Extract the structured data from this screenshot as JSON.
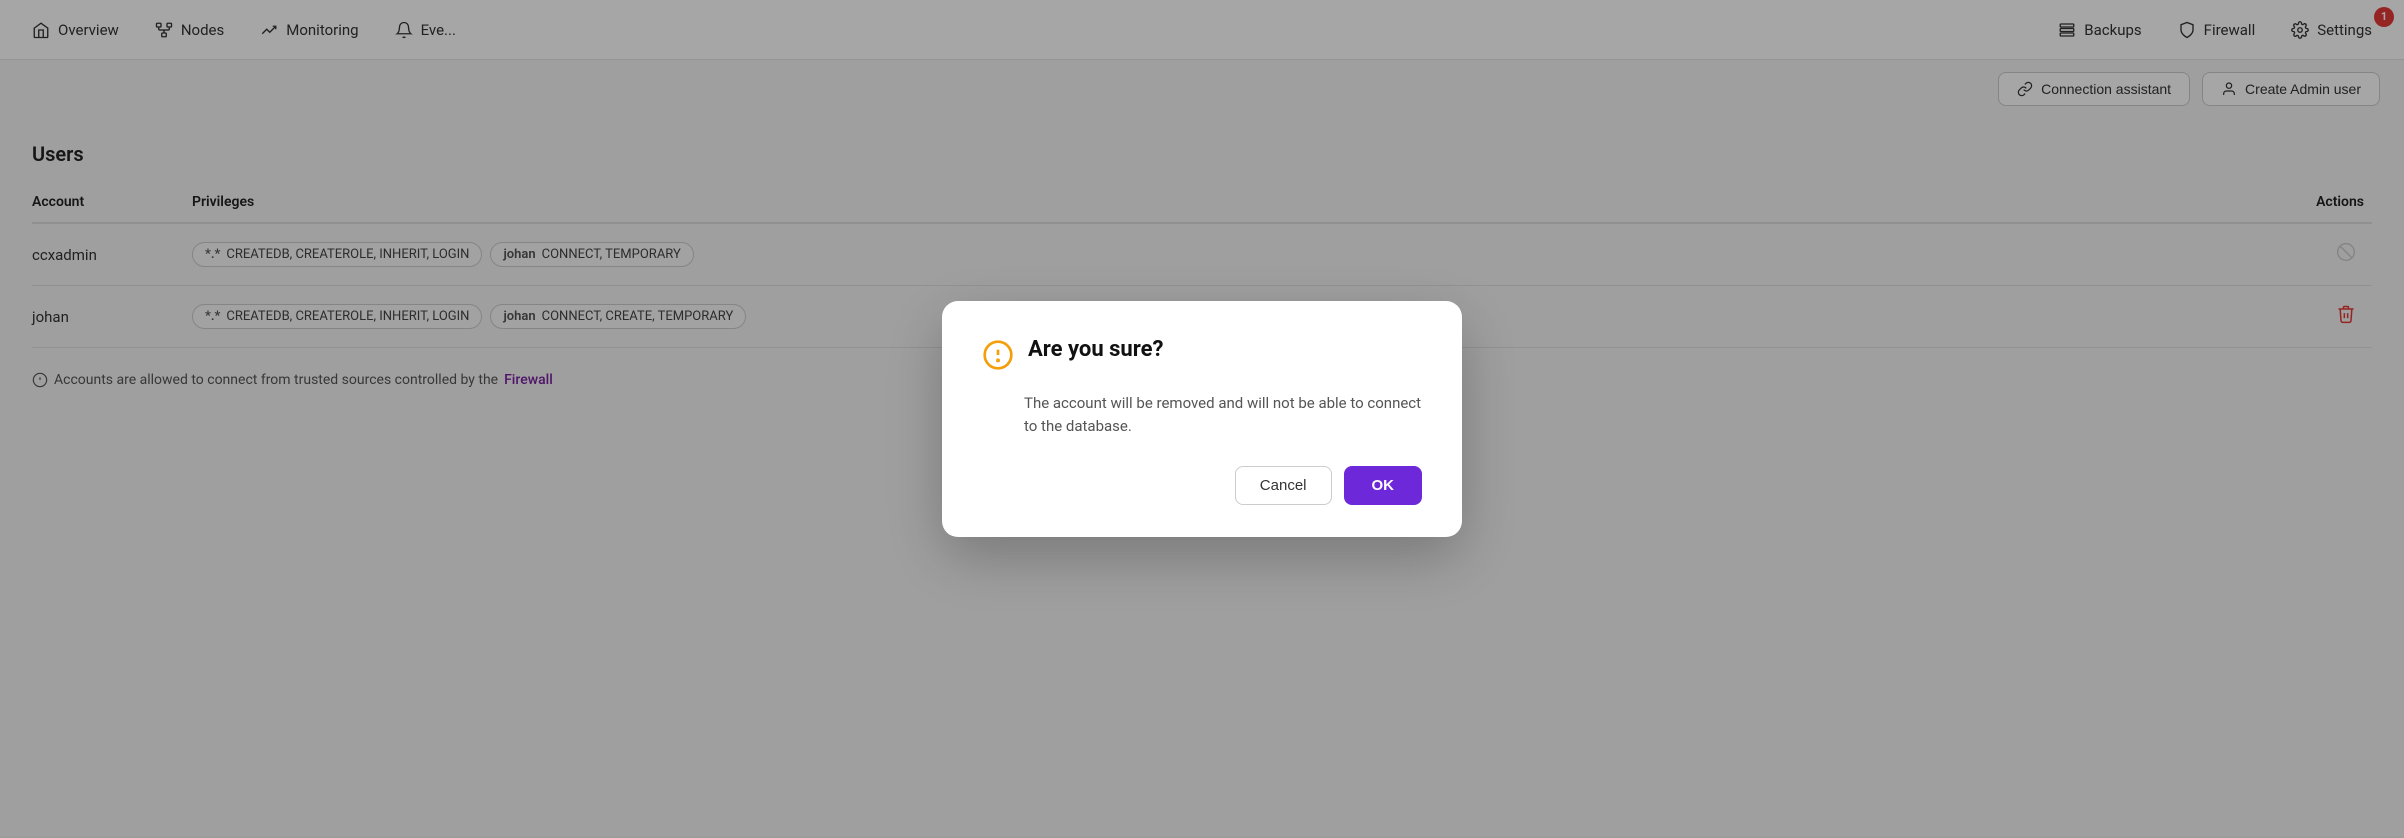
{
  "nav": {
    "items": [
      {
        "id": "overview",
        "label": "Overview",
        "icon": "home"
      },
      {
        "id": "nodes",
        "label": "Nodes",
        "icon": "nodes"
      },
      {
        "id": "monitoring",
        "label": "Monitoring",
        "icon": "chart"
      },
      {
        "id": "events",
        "label": "Eve...",
        "icon": "bell"
      },
      {
        "id": "backups",
        "label": "Backups",
        "icon": "backup"
      },
      {
        "id": "firewall",
        "label": "Firewall",
        "icon": "shield"
      },
      {
        "id": "settings",
        "label": "Settings",
        "icon": "gear"
      }
    ],
    "badge": {
      "count": "1",
      "id": "settings"
    }
  },
  "subtoolbar": {
    "connection_assistant_label": "Connection assistant",
    "create_admin_label": "Create Admin user"
  },
  "users_section": {
    "title": "Users",
    "columns": {
      "account": "Account",
      "privileges": "Privileges",
      "actions": "Actions"
    },
    "rows": [
      {
        "account": "ccxadmin",
        "tags": [
          {
            "dot": "*.*",
            "label": "CREATEDB, CREATEROLE, INHERIT, LOGIN"
          },
          {
            "dot": "johan",
            "label": "CONNECT, TEMPORARY"
          }
        ],
        "deletable": false
      },
      {
        "account": "johan",
        "tags": [
          {
            "dot": "*.*",
            "label": "CREATEDB, CREATEROLE, INHERIT, LOGIN"
          },
          {
            "dot": "johan",
            "label": "CONNECT, CREATE, TEMPORARY"
          }
        ],
        "deletable": true
      }
    ],
    "footer_note": "Accounts are allowed to connect from trusted sources controlled by the",
    "footer_link": "Firewall"
  },
  "modal": {
    "title": "Are you sure?",
    "body": "The account will be removed and will not be able to connect to the database.",
    "cancel_label": "Cancel",
    "ok_label": "OK",
    "warn_icon": "⚠"
  }
}
